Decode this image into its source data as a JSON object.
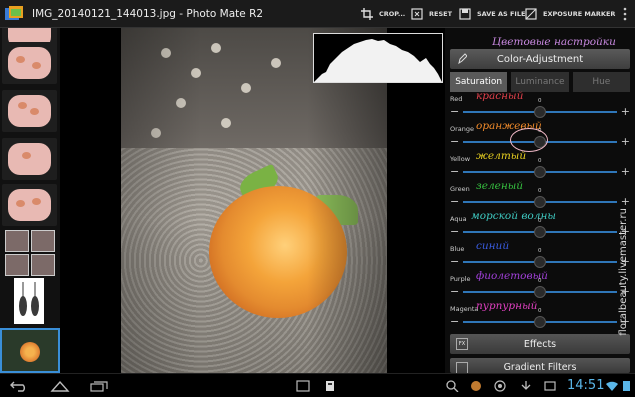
{
  "app": {
    "title": "IMG_20140121_144013.jpg - Photo Mate R2"
  },
  "actions": [
    {
      "label": "CROP...",
      "icon": "crop-icon"
    },
    {
      "label": "RESET",
      "icon": "reset-icon"
    },
    {
      "label": "SAVE AS FILE",
      "icon": "save-icon"
    },
    {
      "label": "EXPOSURE MARKER",
      "icon": "exposure-marker-icon"
    }
  ],
  "panel": {
    "note_title": "Цветовые настройки",
    "header": "Color-Adjustment",
    "tabs": [
      {
        "label": "Saturation",
        "active": true
      },
      {
        "label": "Luminance",
        "active": false
      },
      {
        "label": "Hue",
        "active": false
      }
    ],
    "sliders": [
      {
        "label": "Red",
        "note": "красный",
        "note_color": "#e0404a",
        "value": "0",
        "level": 0.5
      },
      {
        "label": "Orange",
        "note": "оранжевый",
        "note_color": "#f08a2a",
        "value": "0",
        "level": 0.5
      },
      {
        "label": "Yellow",
        "note": "желтый",
        "note_color": "#e8d020",
        "value": "0",
        "level": 0.5
      },
      {
        "label": "Green",
        "note": "зеленый",
        "note_color": "#36c040",
        "value": "0",
        "level": 0.5
      },
      {
        "label": "Aqua",
        "note": "морской волны",
        "note_color": "#3ec8c0",
        "value": "0",
        "level": 0.5
      },
      {
        "label": "Blue",
        "note": "синий",
        "note_color": "#3a5ce0",
        "value": "0",
        "level": 0.5
      },
      {
        "label": "Purple",
        "note": "фиолетовый",
        "note_color": "#a040d8",
        "value": "0",
        "level": 0.5
      },
      {
        "label": "Magenta",
        "note": "пурпурный",
        "note_color": "#e040c0",
        "value": "0",
        "level": 0.5
      }
    ],
    "effects_label": "Effects",
    "effects_icon_text": "FX",
    "gradient_label": "Gradient Filters"
  },
  "watermark": "floralbeauty.livemaster.ru",
  "status": {
    "time": "14:51"
  },
  "colors": {
    "accent": "#2f76b8",
    "clock": "#5ab6e8"
  }
}
